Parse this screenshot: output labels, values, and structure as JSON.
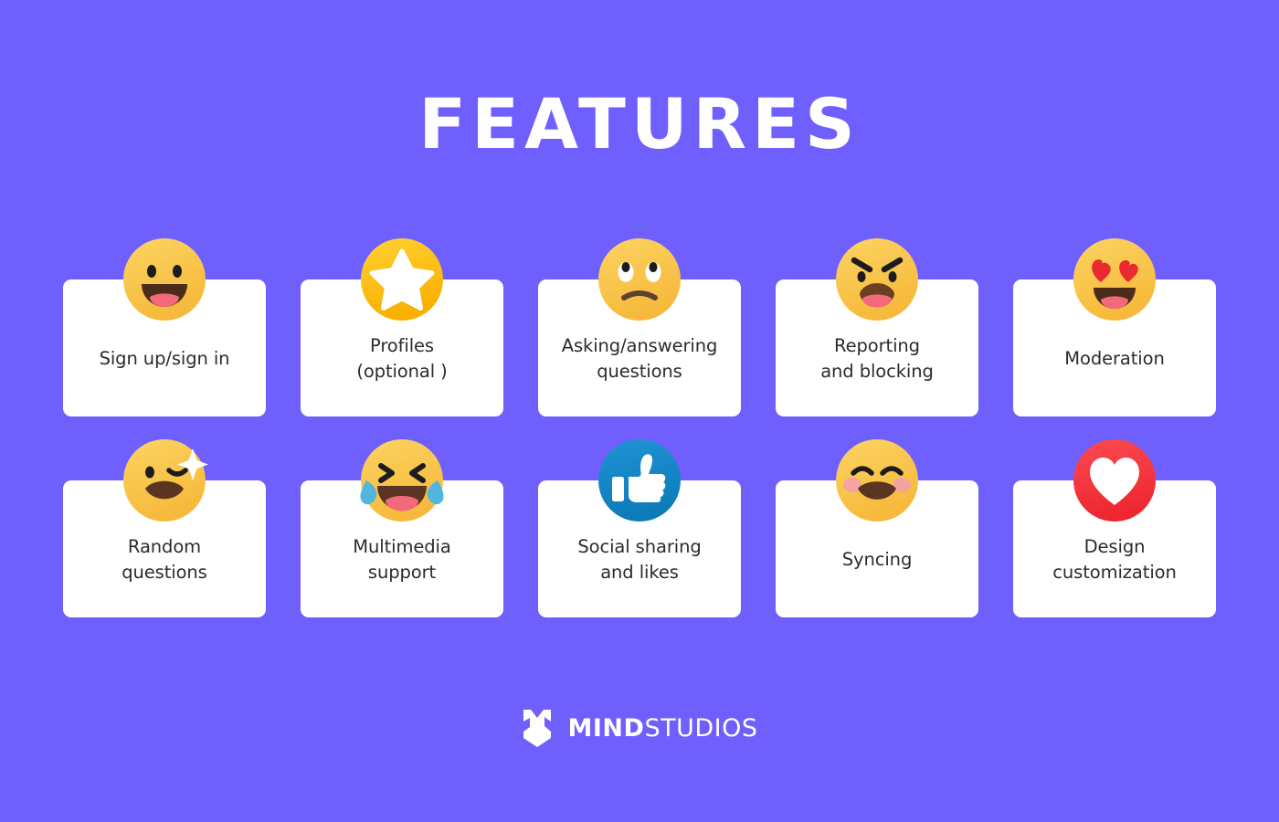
{
  "page": {
    "title": "FEATURES",
    "background_color": "#6f5ffc",
    "card_color": "#ffffff",
    "text_color": "#2b2b30"
  },
  "cards": [
    {
      "label": "Sign up/sign in",
      "icon": "grinning-face-emoji",
      "icon_color": "#fbc84a"
    },
    {
      "label": "Profiles\n(optional )",
      "icon": "star-badge-icon",
      "icon_color": "#fbbe18"
    },
    {
      "label": "Asking/answering\nquestions",
      "icon": "rolling-eyes-face-emoji",
      "icon_color": "#fbc84a"
    },
    {
      "label": "Reporting\nand blocking",
      "icon": "angry-face-emoji",
      "icon_color": "#fbc84a"
    },
    {
      "label": "Moderation",
      "icon": "heart-eyes-face-emoji",
      "icon_color": "#fbc84a"
    },
    {
      "label": "Random\nquestions",
      "icon": "winking-face-emoji",
      "icon_color": "#fbc84a"
    },
    {
      "label": "Multimedia\nsupport",
      "icon": "tears-of-joy-face-emoji",
      "icon_color": "#fbc84a"
    },
    {
      "label": "Social sharing\nand likes",
      "icon": "thumbs-up-icon",
      "icon_color": "#1387c8"
    },
    {
      "label": "Syncing",
      "icon": "blushing-face-emoji",
      "icon_color": "#fbc84a"
    },
    {
      "label": "Design\ncustomization",
      "icon": "heart-badge-icon",
      "icon_color": "#f4353f"
    }
  ],
  "footer": {
    "logo_mark": "mindstudios-shield-logo",
    "brand_bold": "MIND",
    "brand_light": "STUDIOS"
  }
}
